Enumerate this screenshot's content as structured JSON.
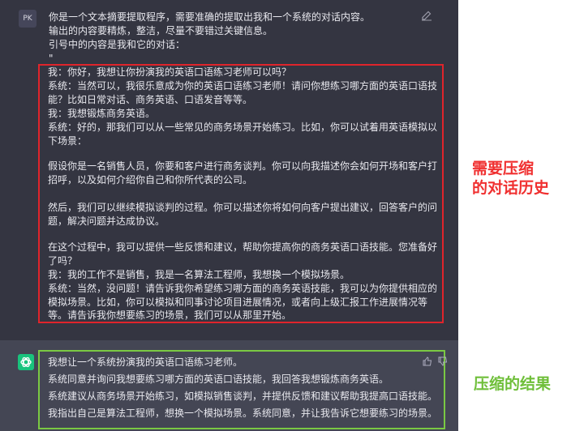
{
  "user": {
    "avatar_text": "PK",
    "prompt_lines": [
      "你是一个文本摘要提取程序，需要准确的提取出我和一个系统的对话内容。",
      "输出的内容要精炼，整洁，尽量不要错过关键信息。",
      "引号中的内容是我和它的对话：",
      "\""
    ],
    "dialog_lines": [
      "我：你好，我想让你扮演我的英语口语练习老师可以吗？",
      "系统：当然可以，我很乐意成为你的英语口语练习老师！请问你想练习哪方面的英语口语技",
      "能？比如日常对话、商务英语、口语发音等等。",
      "我：我想锻炼商务英语。",
      "系统：好的，那我们可以从一些常见的商务场景开始练习。比如，你可以试着用英语模拟以",
      "下场景：",
      "",
      "假设你是一名销售人员，你要和客户进行商务谈判。你可以向我描述你会如何开场和客户打",
      "招呼，以及如何介绍你自己和你所代表的公司。",
      "",
      "然后，我们可以继续模拟谈判的过程。你可以描述你将如何向客户提出建议，回答客户的问",
      "题，解决问题并达成协议。",
      "",
      "在这个过程中，我可以提供一些反馈和建议，帮助你提高你的商务英语口语技能。您准备好",
      "了吗？",
      "我：我的工作不是销售，我是一名算法工程师，我想换一个模拟场景。",
      "系统：当然，没问题！请告诉我你希望练习哪方面的商务英语技能，我可以为你提供相应的",
      "模拟场景。比如，你可以模拟和同事讨论项目进展情况，或者向上级汇报工作进展情况等",
      "等。请告诉我你想要练习的场景，我们可以从那里开始。"
    ]
  },
  "assistant": {
    "result_lines": [
      "我想让一个系统扮演我的英语口语练习老师。",
      "系统同意并询问我想要练习哪方面的英语口语技能，我回答我想锻炼商务英语。",
      "系统建议从商务场景开始练习，如模拟销售谈判，并提供反馈和建议帮助我提高口语技能。",
      "我指出自己是算法工程师，想换一个模拟场景。系统同意，并让我告诉它想要练习的场景。"
    ]
  },
  "annotations": {
    "history_line1": "需要压缩",
    "history_line2": "的对话历史",
    "result_label": "压缩的结果"
  },
  "colors": {
    "history_border": "#e0242b",
    "result_border": "#7ac943",
    "gpt_avatar": "#19c37d"
  }
}
